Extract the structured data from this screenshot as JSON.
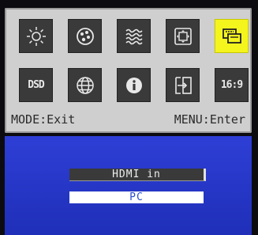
{
  "osd": {
    "icons": [
      {
        "name": "brightness-icon",
        "selected": false
      },
      {
        "name": "color-palette-icon",
        "selected": false
      },
      {
        "name": "noise-reduction-icon",
        "selected": false
      },
      {
        "name": "image-position-icon",
        "selected": false
      },
      {
        "name": "input-source-icon",
        "selected": true
      },
      {
        "name": "dsd-icon",
        "label": "DSD",
        "selected": false
      },
      {
        "name": "language-globe-icon",
        "selected": false
      },
      {
        "name": "information-icon",
        "selected": false
      },
      {
        "name": "signal-switch-icon",
        "selected": false
      },
      {
        "name": "aspect-ratio-icon",
        "label": "16:9",
        "selected": false
      }
    ],
    "hints": {
      "left": "MODE:Exit",
      "right": "MENU:Enter"
    },
    "colors": {
      "selected": "#f5f51e",
      "tile": "#3a3a3a",
      "panel": "#cfcfcf",
      "submenu": "#2636c8"
    }
  },
  "source_menu": {
    "options": [
      "HDMI in",
      "PC"
    ],
    "selected": "PC"
  }
}
